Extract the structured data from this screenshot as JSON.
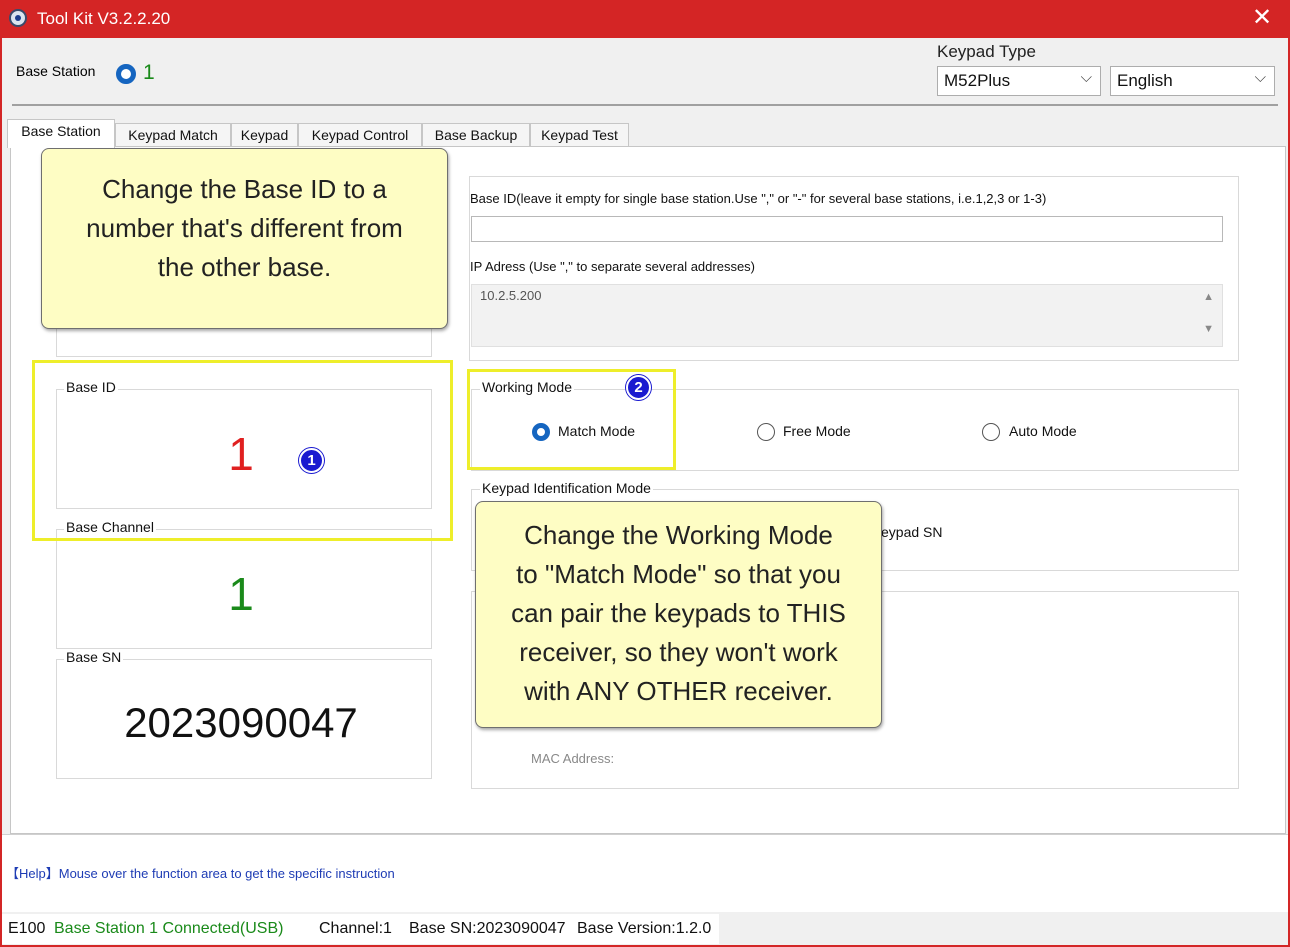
{
  "window": {
    "title": "Tool Kit  V3.2.2.20",
    "close": "✕"
  },
  "header": {
    "base_station_label": "Base Station",
    "base_station_value": "1",
    "keypad_type_label": "Keypad Type",
    "keypad_type_value": "M52Plus",
    "language_value": "English"
  },
  "tabs": [
    {
      "label": "Base Station",
      "active": true
    },
    {
      "label": "Keypad Match"
    },
    {
      "label": "Keypad"
    },
    {
      "label": "Keypad Control"
    },
    {
      "label": "Base Backup"
    },
    {
      "label": "Keypad Test"
    }
  ],
  "base_id_config": {
    "label": "Base ID(leave it empty for single base station.Use \",\" or \"-\" for several base stations, i.e.1,2,3 or 1-3)",
    "value": "",
    "ip_label": "IP Adress (Use \",\" to separate several addresses)",
    "ip_value": "10.2.5.200"
  },
  "base_id": {
    "label": "Base ID",
    "value": "1"
  },
  "base_channel": {
    "label": "Base Channel",
    "value": "1"
  },
  "base_sn": {
    "label": "Base SN",
    "value": "2023090047"
  },
  "working_mode": {
    "label": "Working Mode",
    "options": [
      "Match Mode",
      "Free Mode",
      "Auto Mode"
    ],
    "selected": "Match Mode"
  },
  "keypad_id_mode": {
    "label": "Keypad Identification Mode",
    "visible_option_fragment": "eypad SN"
  },
  "mac": {
    "label": "MAC Address:"
  },
  "annotations": {
    "note1": [
      "Change the Base ID to a",
      "number that's different from",
      "the other base."
    ],
    "note2": [
      "Change the Working Mode",
      "to \"Match Mode\" so that you",
      "can pair the keypads to THIS",
      "receiver, so they won't work",
      "with ANY OTHER receiver."
    ],
    "badge1": "1",
    "badge2": "2",
    "highlight_color": "#eeee2a",
    "note_color": "#fefdc4"
  },
  "help": {
    "text": "【Help】Mouse over the function area to get the specific instruction"
  },
  "status": {
    "model": "E100",
    "connection": "Base Station 1 Connected(USB)",
    "channel": "Channel:1",
    "sn": "Base SN:2023090047",
    "version": "Base Version:1.2.0"
  },
  "colors": {
    "title_bar": "#d42525",
    "accent": "#1565c0",
    "green": "#1a8a1a",
    "red": "#e02020"
  }
}
